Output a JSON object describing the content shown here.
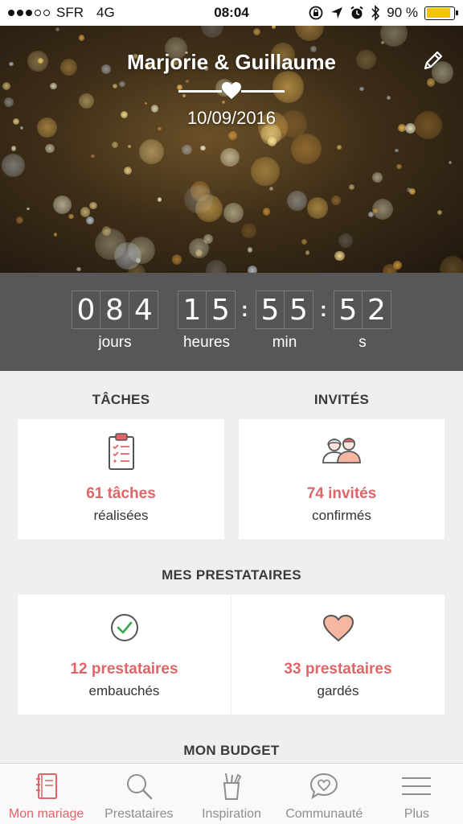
{
  "status_bar": {
    "carrier": "SFR",
    "network": "4G",
    "time": "08:04",
    "battery": "90 %",
    "battery_level": 0.9
  },
  "header": {
    "names": "Marjorie & Guillaume",
    "date": "10/09/2016"
  },
  "countdown": {
    "days": [
      "0",
      "8",
      "4"
    ],
    "hours": [
      "1",
      "5"
    ],
    "minutes": [
      "5",
      "5"
    ],
    "seconds": [
      "5",
      "2"
    ],
    "labels": {
      "days": "jours",
      "hours": "heures",
      "minutes": "min",
      "seconds": "s"
    }
  },
  "sections": {
    "tasks": {
      "title": "TÂCHES",
      "main": "61 tâches",
      "sub": "réalisées"
    },
    "guests": {
      "title": "INVITÉS",
      "main": "74 invités",
      "sub": "confirmés"
    },
    "vendors": {
      "title": "MES PRESTATAIRES",
      "hired_main": "12 prestataires",
      "hired_sub": "embauchés",
      "saved_main": "33 prestataires",
      "saved_sub": "gardés"
    },
    "budget": {
      "title": "MON BUDGET"
    }
  },
  "tabbar": {
    "items": [
      {
        "label": "Mon mariage",
        "icon": "notebook-icon",
        "active": true
      },
      {
        "label": "Prestataires",
        "icon": "search-icon",
        "active": false
      },
      {
        "label": "Inspiration",
        "icon": "cup-icon",
        "active": false
      },
      {
        "label": "Communauté",
        "icon": "chat-heart-icon",
        "active": false
      },
      {
        "label": "Plus",
        "icon": "menu-icon",
        "active": false
      }
    ]
  },
  "colors": {
    "accent": "#e06468",
    "countdown_bg": "#575757",
    "page_bg": "#efefef"
  }
}
